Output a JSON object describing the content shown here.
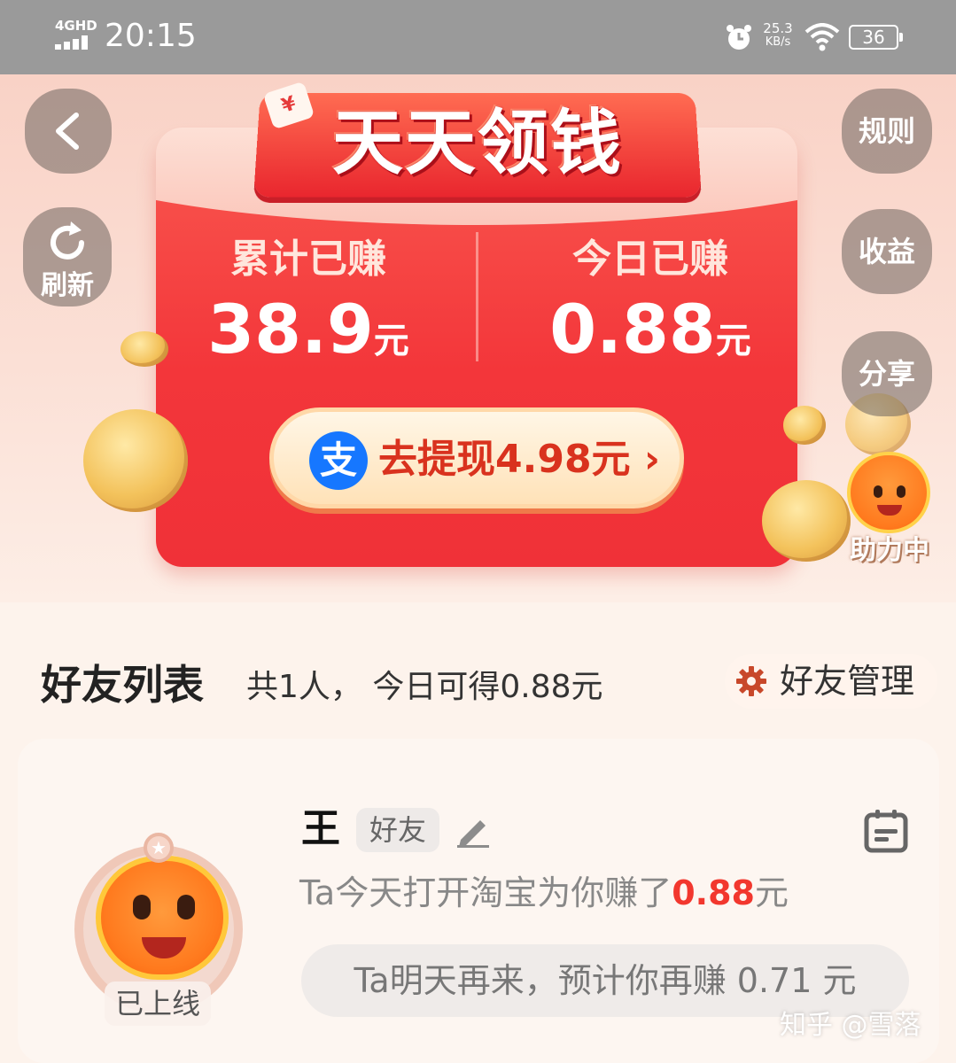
{
  "status_bar": {
    "network": "4GHD",
    "time": "20:15",
    "speed_value": "25.3",
    "speed_unit": "KB/s",
    "battery": "36"
  },
  "nav": {
    "back_icon": "chevron-left-icon",
    "refresh_label": "刷新",
    "rules_label": "规则",
    "earnings_label": "收益",
    "share_label": "分享"
  },
  "banner": {
    "tag_glyph": "¥",
    "title": "天天领钱",
    "total_label": "累计已赚",
    "total_value": "38.9",
    "today_label": "今日已赚",
    "today_value": "0.88",
    "currency": "元",
    "withdraw_label": "去提现4.98元 ›",
    "alipay_glyph": "支",
    "helper_label": "助力中"
  },
  "friends": {
    "title": "好友列表",
    "summary": "共1人， 今日可得0.88元",
    "manage_label": "好友管理",
    "items": [
      {
        "name": "王",
        "tag": "好友",
        "status": "已上线",
        "earn_prefix": "Ta今天打开淘宝为你赚了",
        "earn_amount": "0.88",
        "earn_suffix": "元",
        "tomorrow": "Ta明天再来，预计你再赚 0.71 元"
      }
    ]
  },
  "watermark": "知乎 @雪落",
  "colors": {
    "accent_red": "#f2372e",
    "card_red": "#f03138",
    "alipay_blue": "#1677ff",
    "status_bar": "#9a9a9a"
  }
}
